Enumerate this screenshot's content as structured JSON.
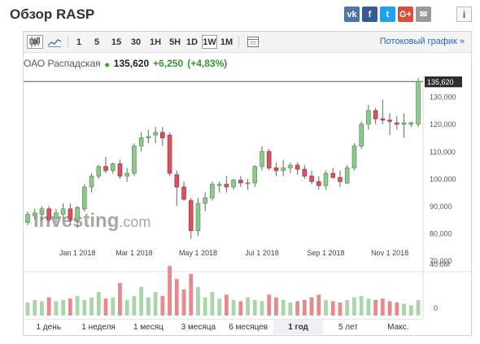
{
  "header": {
    "title": "Обзор RASP"
  },
  "share": [
    {
      "name": "vk-icon",
      "glyph": "vk",
      "color": "#4a76a8"
    },
    {
      "name": "facebook-icon",
      "glyph": "f",
      "color": "#3b5998"
    },
    {
      "name": "twitter-icon",
      "glyph": "t",
      "color": "#1da1f2"
    },
    {
      "name": "google-plus-icon",
      "glyph": "G+",
      "color": "#dd4b39"
    },
    {
      "name": "email-icon",
      "glyph": "✉",
      "color": "#9a9a9a"
    }
  ],
  "info_glyph": "i",
  "toolbar": {
    "timeframes": [
      "1",
      "5",
      "15",
      "30",
      "1H",
      "5H",
      "1D",
      "1W",
      "1M"
    ],
    "active_timeframe": "1W",
    "stream_link": "Потоковый график »"
  },
  "quote": {
    "name": "ОАО Распадская",
    "arrow": "◆",
    "price": "135,620",
    "change": "+6,250",
    "change_pct": "(+4,83%)"
  },
  "ranges": {
    "items": [
      "1 день",
      "1 неделя",
      "1 месяц",
      "3 месяца",
      "6 месяцев",
      "1 год",
      "5 лет",
      "Макс."
    ],
    "active": "1 год"
  },
  "colors": {
    "up": "#8fc98f",
    "down": "#d9535f",
    "vol_up": "#a9d6a9",
    "vol_down": "#e8888f",
    "up_edge": "#5a9a5a",
    "down_edge": "#a83a44"
  },
  "chart_data": {
    "type": "candlestick",
    "watermark": "Investing.com",
    "y_ticks": [
      70000,
      80000,
      90000,
      100000,
      110000,
      120000,
      130000
    ],
    "y_tick_labels": [
      "70,000",
      "80,000",
      "90,000",
      "100,000",
      "110,000",
      "120,000",
      "130,000"
    ],
    "ylim": [
      66000,
      137500
    ],
    "x_labels": [
      {
        "label": "Jan 1 2018",
        "index": 7
      },
      {
        "label": "Mar 1 2018",
        "index": 15
      },
      {
        "label": "May 1 2018",
        "index": 24
      },
      {
        "label": "Jul 1 2018",
        "index": 33
      },
      {
        "label": "Sep 1 2018",
        "index": 42
      },
      {
        "label": "Nov 1 2018",
        "index": 51
      }
    ],
    "last_price": 135620,
    "last_price_label": "135,620",
    "volume_label": "40.0M",
    "volume_zero_label": "0",
    "volume_max": 40,
    "candles": [
      {
        "o": 84000,
        "h": 88000,
        "l": 83000,
        "c": 87000,
        "v": 10
      },
      {
        "o": 86500,
        "h": 89000,
        "l": 85000,
        "c": 87500,
        "v": 12
      },
      {
        "o": 87000,
        "h": 90000,
        "l": 85000,
        "c": 89000,
        "v": 11
      },
      {
        "o": 89000,
        "h": 90000,
        "l": 84000,
        "c": 85000,
        "v": 14
      },
      {
        "o": 85500,
        "h": 89000,
        "l": 84000,
        "c": 87500,
        "v": 11
      },
      {
        "o": 87000,
        "h": 91000,
        "l": 85000,
        "c": 89000,
        "v": 12
      },
      {
        "o": 89000,
        "h": 91000,
        "l": 83000,
        "c": 85000,
        "v": 13
      },
      {
        "o": 85000,
        "h": 90000,
        "l": 82000,
        "c": 89500,
        "v": 15
      },
      {
        "o": 89000,
        "h": 98000,
        "l": 88000,
        "c": 97000,
        "v": 12
      },
      {
        "o": 97000,
        "h": 102000,
        "l": 95000,
        "c": 101000,
        "v": 14
      },
      {
        "o": 101000,
        "h": 105000,
        "l": 100000,
        "c": 104500,
        "v": 18
      },
      {
        "o": 104500,
        "h": 108000,
        "l": 102000,
        "c": 103000,
        "v": 13
      },
      {
        "o": 103000,
        "h": 106000,
        "l": 102000,
        "c": 105500,
        "v": 14
      },
      {
        "o": 105500,
        "h": 107000,
        "l": 100000,
        "c": 101000,
        "v": 25
      },
      {
        "o": 101000,
        "h": 104000,
        "l": 99000,
        "c": 102000,
        "v": 12
      },
      {
        "o": 102000,
        "h": 113000,
        "l": 101000,
        "c": 112000,
        "v": 15
      },
      {
        "o": 112000,
        "h": 117000,
        "l": 110000,
        "c": 115000,
        "v": 22
      },
      {
        "o": 115000,
        "h": 118000,
        "l": 113000,
        "c": 115500,
        "v": 14
      },
      {
        "o": 116000,
        "h": 119000,
        "l": 113000,
        "c": 117000,
        "v": 18
      },
      {
        "o": 117000,
        "h": 119000,
        "l": 112000,
        "c": 115000,
        "v": 15
      },
      {
        "o": 116000,
        "h": 117000,
        "l": 101000,
        "c": 102000,
        "v": 38
      },
      {
        "o": 101500,
        "h": 103000,
        "l": 90000,
        "c": 97000,
        "v": 28
      },
      {
        "o": 97000,
        "h": 99000,
        "l": 92000,
        "c": 92500,
        "v": 20
      },
      {
        "o": 92000,
        "h": 93000,
        "l": 78000,
        "c": 81000,
        "v": 32
      },
      {
        "o": 81000,
        "h": 93000,
        "l": 79000,
        "c": 91000,
        "v": 22
      },
      {
        "o": 91000,
        "h": 95000,
        "l": 88000,
        "c": 93000,
        "v": 14
      },
      {
        "o": 93000,
        "h": 99000,
        "l": 92000,
        "c": 98000,
        "v": 18
      },
      {
        "o": 97500,
        "h": 99000,
        "l": 95000,
        "c": 98000,
        "v": 13
      },
      {
        "o": 98000,
        "h": 101000,
        "l": 95000,
        "c": 97000,
        "v": 16
      },
      {
        "o": 97000,
        "h": 100000,
        "l": 96000,
        "c": 99500,
        "v": 12
      },
      {
        "o": 99500,
        "h": 101000,
        "l": 97000,
        "c": 98500,
        "v": 11
      },
      {
        "o": 98500,
        "h": 100000,
        "l": 96000,
        "c": 98500,
        "v": 14
      },
      {
        "o": 98500,
        "h": 105000,
        "l": 97000,
        "c": 104500,
        "v": 12
      },
      {
        "o": 104500,
        "h": 112000,
        "l": 103000,
        "c": 110000,
        "v": 11
      },
      {
        "o": 110000,
        "h": 111000,
        "l": 103000,
        "c": 104000,
        "v": 16
      },
      {
        "o": 104000,
        "h": 106000,
        "l": 101000,
        "c": 103000,
        "v": 14
      },
      {
        "o": 103000,
        "h": 107000,
        "l": 101000,
        "c": 104000,
        "v": 12
      },
      {
        "o": 104000,
        "h": 106000,
        "l": 102000,
        "c": 105000,
        "v": 10
      },
      {
        "o": 105000,
        "h": 106000,
        "l": 101500,
        "c": 103500,
        "v": 11
      },
      {
        "o": 103500,
        "h": 105000,
        "l": 100000,
        "c": 101000,
        "v": 12
      },
      {
        "o": 101000,
        "h": 103000,
        "l": 98000,
        "c": 99000,
        "v": 14
      },
      {
        "o": 99000,
        "h": 101000,
        "l": 96000,
        "c": 97500,
        "v": 16
      },
      {
        "o": 97500,
        "h": 103000,
        "l": 96000,
        "c": 102000,
        "v": 12
      },
      {
        "o": 102000,
        "h": 104000,
        "l": 100000,
        "c": 100500,
        "v": 11
      },
      {
        "o": 100500,
        "h": 103000,
        "l": 97000,
        "c": 99000,
        "v": 10
      },
      {
        "o": 98500,
        "h": 105000,
        "l": 98000,
        "c": 104000,
        "v": 12
      },
      {
        "o": 104000,
        "h": 113000,
        "l": 103000,
        "c": 112000,
        "v": 14
      },
      {
        "o": 112000,
        "h": 121000,
        "l": 111000,
        "c": 120000,
        "v": 15
      },
      {
        "o": 120000,
        "h": 127000,
        "l": 118000,
        "c": 125000,
        "v": 13
      },
      {
        "o": 125000,
        "h": 126000,
        "l": 120000,
        "c": 122000,
        "v": 12
      },
      {
        "o": 122000,
        "h": 129000,
        "l": 120000,
        "c": 121500,
        "v": 13
      },
      {
        "o": 121500,
        "h": 124000,
        "l": 116000,
        "c": 121000,
        "v": 11
      },
      {
        "o": 120500,
        "h": 123000,
        "l": 118000,
        "c": 120000,
        "v": 10
      },
      {
        "o": 120000,
        "h": 124000,
        "l": 115000,
        "c": 120500,
        "v": 9
      },
      {
        "o": 120000,
        "h": 121000,
        "l": 119000,
        "c": 120500,
        "v": 8
      },
      {
        "o": 120000,
        "h": 137000,
        "l": 119000,
        "c": 135620,
        "v": 12
      }
    ]
  }
}
